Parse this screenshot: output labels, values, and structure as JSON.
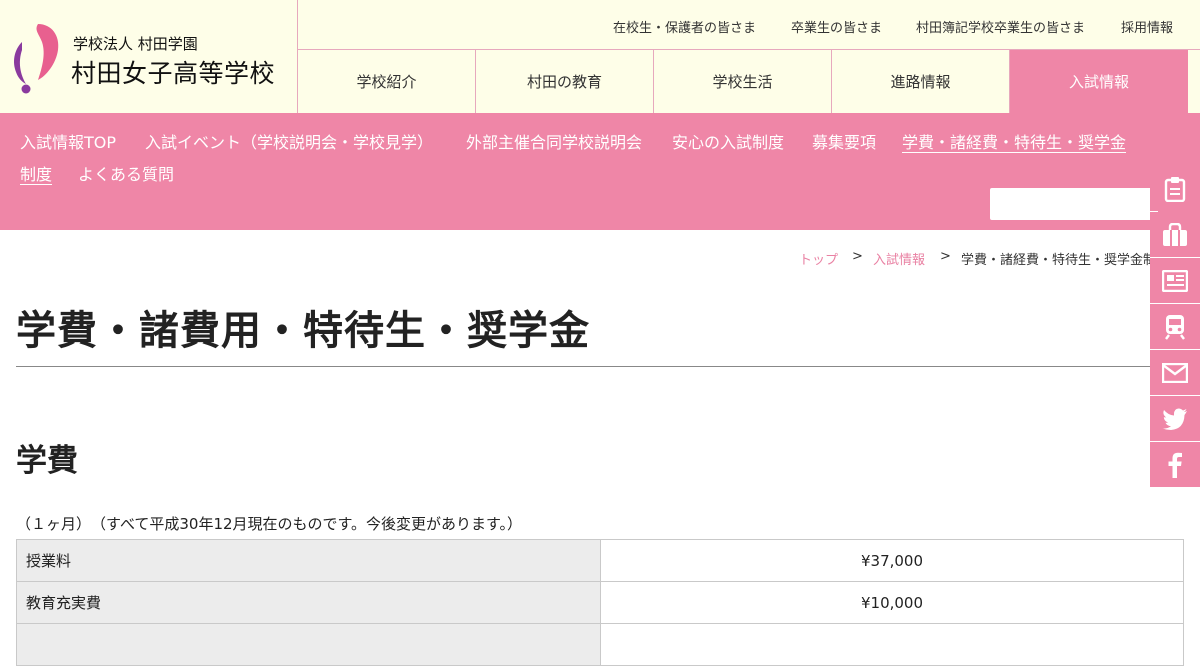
{
  "header": {
    "logo_sub": "学校法人 村田学園",
    "logo_main": "村田女子高等学校",
    "top_links": [
      "在校生・保護者の皆さま",
      "卒業生の皆さま",
      "村田簿記学校卒業生の皆さま",
      "採用情報"
    ],
    "nav": [
      "学校紹介",
      "村田の教育",
      "学校生活",
      "進路情報",
      "入試情報"
    ],
    "active_nav": "入試情報"
  },
  "subnav": {
    "links": [
      "入試情報TOP",
      "入試イベント（学校説明会・学校見学）",
      "外部主催合同学校説明会",
      "安心の入試制度",
      "募集要項",
      "学費・諸経費・特待生・奨学金",
      "制度",
      "よくある質問"
    ],
    "current": "学費・諸経費・特待生・奨学金制度",
    "search_placeholder": ""
  },
  "side_buttons": [
    "clipboard-icon",
    "bag-icon",
    "newspaper-icon",
    "train-icon",
    "mail-icon",
    "twitter-icon",
    "facebook-icon"
  ],
  "breadcrumb": {
    "home": "トップ",
    "sep": ">",
    "parent": "入試情報",
    "current": "学費・諸経費・特待生・奨学金制度"
  },
  "page": {
    "title": "学費・諸費用・特待生・奨学金",
    "section_title": "学費",
    "note": "（１ヶ月）　（すべて平成30年12月現在のものです。今後変更があります。）",
    "fees": [
      {
        "label": "授業料",
        "value": "¥37,000"
      },
      {
        "label": "教育充実費",
        "value": "¥10,000"
      }
    ]
  },
  "colors": {
    "accent": "#ef86a7",
    "header_bg": "#fefee8",
    "logo_pink": "#e8608f",
    "logo_purple": "#8a3a9e"
  }
}
